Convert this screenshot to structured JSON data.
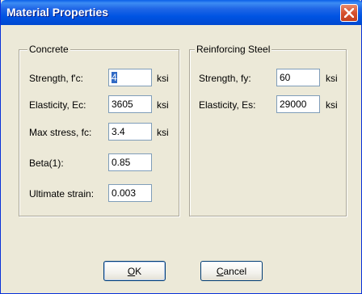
{
  "window": {
    "title": "Material Properties"
  },
  "concrete": {
    "label": "Concrete",
    "rows": [
      {
        "label": "Strength, f'c:",
        "value": "4",
        "unit": "ksi"
      },
      {
        "label": "Elasticity, Ec:",
        "value": "3605",
        "unit": "ksi"
      },
      {
        "label": "Max stress, fc:",
        "value": "3.4",
        "unit": "ksi"
      },
      {
        "label": "Beta(1):",
        "value": "0.85",
        "unit": ""
      },
      {
        "label": "Ultimate strain:",
        "value": "0.003",
        "unit": ""
      }
    ]
  },
  "steel": {
    "label": "Reinforcing Steel",
    "rows": [
      {
        "label": "Strength, fy:",
        "value": "60",
        "unit": "ksi"
      },
      {
        "label": "Elasticity, Es:",
        "value": "29000",
        "unit": "ksi"
      }
    ]
  },
  "buttons": {
    "ok": {
      "accel": "O",
      "rest": "K"
    },
    "cancel": {
      "accel": "C",
      "rest": "ancel"
    }
  },
  "icons": {
    "close": "close-icon"
  },
  "colors": {
    "titlebar": "#0054E3",
    "dialog_bg": "#ECE9D8",
    "selection": "#316AC5"
  }
}
